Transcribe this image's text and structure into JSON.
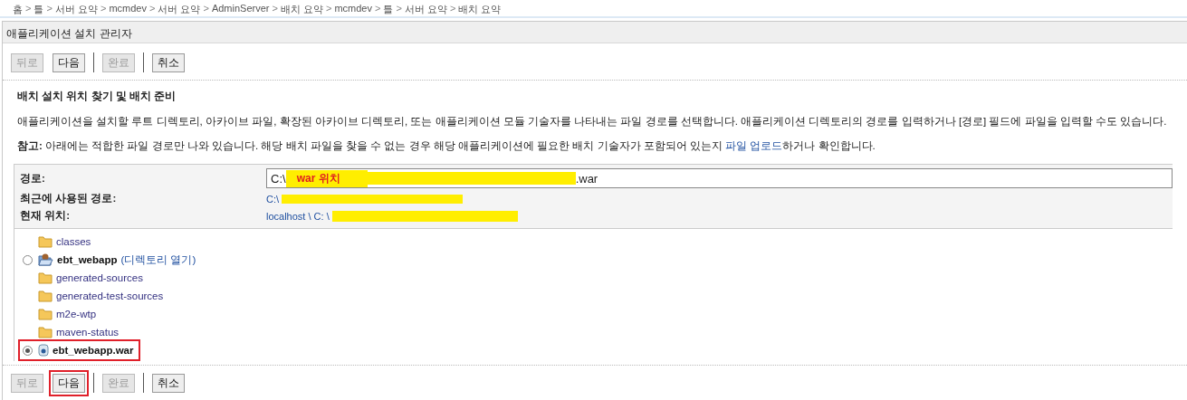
{
  "breadcrumb": [
    "홈",
    "틀",
    "서버 요약",
    "mcmdev",
    "서버 요약",
    "AdminServer",
    "배치 요약",
    "mcmdev",
    "틀",
    "서버 요약",
    "배치 요약"
  ],
  "breadcrumb_separator": ">",
  "panel": {
    "title": "애플리케이션 설치 관리자"
  },
  "top_buttons": [
    [
      {
        "label": "뒤로",
        "disabled": true,
        "highlighted": false
      },
      {
        "label": "다음",
        "disabled": false,
        "highlighted": false
      }
    ],
    [
      {
        "label": "완료",
        "disabled": true,
        "highlighted": false
      }
    ],
    [
      {
        "label": "취소",
        "disabled": false,
        "highlighted": false
      }
    ]
  ],
  "heading": "배치 설치 위치 찾기 및 배치 준비",
  "description": "애플리케이션을 설치할 루트 디렉토리, 아카이브 파일, 확장된 아카이브 디렉토리, 또는 애플리케이션 모듈 기술자를 나타내는 파일 경로를 선택합니다. 애플리케이션 디렉토리의 경로를 입력하거나 [경로] 필드에 파일을 입력할 수도 있습니다.",
  "note": {
    "label": "참고:",
    "text_before": " 아래에는 적합한 파일 경로만 나와 있습니다. 해당 배치 파일을 찾을 수 없는 경우 해당 애플리케이션에 필요한 배치 기술자가 포함되어 있는지 ",
    "link": "파일 업로드",
    "text_after": "하거나 확인합니다."
  },
  "form": {
    "path_label": "경로:",
    "path_prefix": "C:\\",
    "path_annotation": "war 위치",
    "path_suffix": ".war",
    "recent_label": "최근에 사용된 경로:",
    "recent_value": "C:\\",
    "current_label": "현재 위치:",
    "current_value": "localhost \\ C: \\"
  },
  "tree": [
    {
      "name": "classes",
      "kind": "folder",
      "radio": false,
      "bold": false,
      "highlighted": false
    },
    {
      "name": "ebt_webapp",
      "kind": "open-folder",
      "radio": true,
      "selected": false,
      "bold": true,
      "link": "(디렉토리 열기)",
      "highlighted": false
    },
    {
      "name": "generated-sources",
      "kind": "folder",
      "radio": false,
      "bold": false,
      "highlighted": false
    },
    {
      "name": "generated-test-sources",
      "kind": "folder",
      "radio": false,
      "bold": false,
      "highlighted": false
    },
    {
      "name": "m2e-wtp",
      "kind": "folder",
      "radio": false,
      "bold": false,
      "highlighted": false
    },
    {
      "name": "maven-status",
      "kind": "folder",
      "radio": false,
      "bold": false,
      "highlighted": false
    },
    {
      "name": "ebt_webapp.war",
      "kind": "archive",
      "radio": true,
      "selected": true,
      "bold": true,
      "highlighted": true
    }
  ],
  "bottom_buttons": [
    [
      {
        "label": "뒤로",
        "disabled": true,
        "highlighted": false
      },
      {
        "label": "다음",
        "disabled": false,
        "highlighted": true
      }
    ],
    [
      {
        "label": "완료",
        "disabled": true,
        "highlighted": false
      }
    ],
    [
      {
        "label": "취소",
        "disabled": false,
        "highlighted": false
      }
    ]
  ]
}
